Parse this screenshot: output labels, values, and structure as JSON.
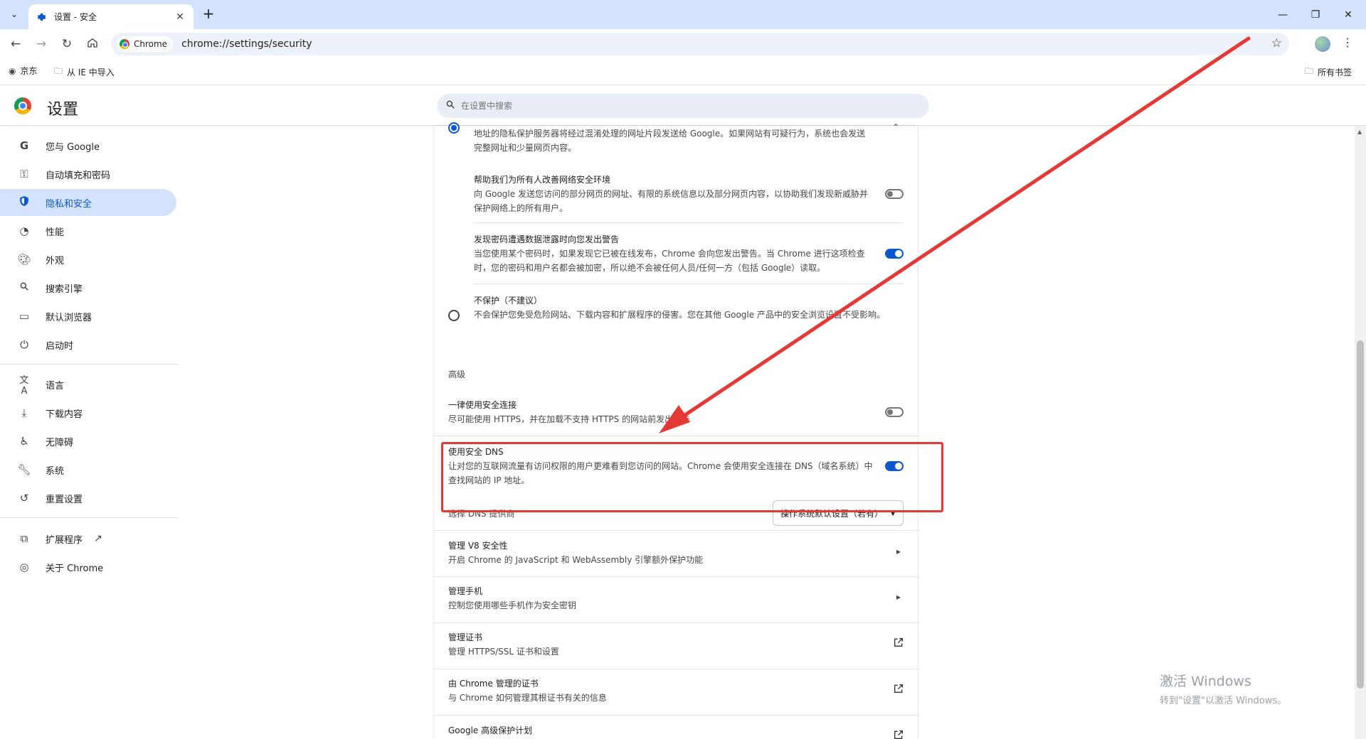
{
  "browser": {
    "tab_title": "设置 - 安全",
    "url_chip": "Chrome",
    "url": "chrome://settings/security",
    "bookmarks": [
      "京东",
      "从 IE 中导入"
    ],
    "all_bookmarks": "所有书签"
  },
  "settings": {
    "title": "设置",
    "search_placeholder": "在设置中搜索"
  },
  "nav": {
    "items": [
      {
        "label": "您与 Google",
        "icon": "google-icon"
      },
      {
        "label": "自动填充和密码",
        "icon": "key-icon"
      },
      {
        "label": "隐私和安全",
        "icon": "shield-icon"
      },
      {
        "label": "性能",
        "icon": "speedometer-icon"
      },
      {
        "label": "外观",
        "icon": "palette-icon"
      },
      {
        "label": "搜索引擎",
        "icon": "search-icon"
      },
      {
        "label": "默认浏览器",
        "icon": "browser-window-icon"
      },
      {
        "label": "启动时",
        "icon": "power-icon"
      },
      {
        "label": "语言",
        "icon": "translate-icon"
      },
      {
        "label": "下载内容",
        "icon": "download-icon"
      },
      {
        "label": "无障碍",
        "icon": "accessibility-icon"
      },
      {
        "label": "系统",
        "icon": "wrench-icon"
      },
      {
        "label": "重置设置",
        "icon": "reset-icon"
      },
      {
        "label": "扩展程序",
        "icon": "puzzle-icon"
      },
      {
        "label": "关于 Chrome",
        "icon": "chrome-icon"
      }
    ],
    "active": "隐私和安全"
  },
  "content": {
    "enhanced_desc": "地址的隐私保护服务器将经过混淆处理的网址片段发送给 Google。如果网站有可疑行为，系统也会发送完整网址和少量网页内容。",
    "help_title": "帮助我们为所有人改善网络安全环境",
    "help_desc": "向 Google 发送您访问的部分网页的网址、有限的系统信息以及部分网页内容，以协助我们发现新威胁并保护网络上的所有用户。",
    "help_toggle": "off",
    "password_title": "发现密码遭遇数据泄露时向您发出警告",
    "password_desc": "当您使用某个密码时，如果发现它已被在线发布，Chrome 会向您发出警告。当 Chrome 进行这项检查时，您的密码和用户名都会被加密，所以绝不会被任何人员/任何一方（包括 Google）读取。",
    "password_toggle": "on",
    "noprot_title": "不保护（不建议）",
    "noprot_desc": "不会保护您免受危险网站、下载内容和扩展程序的侵害。您在其他 Google 产品中的安全浏览设置不受影响。",
    "advanced_label": "高级",
    "https_title": "一律使用安全连接",
    "https_desc": "尽可能使用 HTTPS，并在加载不支持 HTTPS 的网站前发出警告",
    "https_toggle": "off",
    "dns_title": "使用安全 DNS",
    "dns_desc": "让对您的互联网流量有访问权限的用户更难看到您访问的网站。Chrome 会使用安全连接在 DNS（域名系统）中查找网站的 IP 地址。",
    "dns_toggle": "on",
    "dns_provider_label": "选择 DNS 提供商",
    "dns_provider_value": "操作系统默认设置（若有）",
    "v8_title": "管理 V8 安全性",
    "v8_desc": "开启 Chrome 的 JavaScript 和 WebAssembly 引擎额外保护功能",
    "phone_title": "管理手机",
    "phone_desc": "控制您使用哪些手机作为安全密钥",
    "cert_title": "管理证书",
    "cert_desc": "管理 HTTPS/SSL 证书和设置",
    "chrome_cert_title": "由 Chrome 管理的证书",
    "chrome_cert_desc": "与 Chrome 如何管理其根证书有关的信息",
    "gapp_title": "Google 高级保护计划"
  },
  "watermark": {
    "line1": "激活 Windows",
    "line2": "转到\"设置\"以激活 Windows。"
  },
  "colors": {
    "accent": "#0b57d0",
    "annotation": "#e53935",
    "tabstrip": "#d3e3fd"
  }
}
